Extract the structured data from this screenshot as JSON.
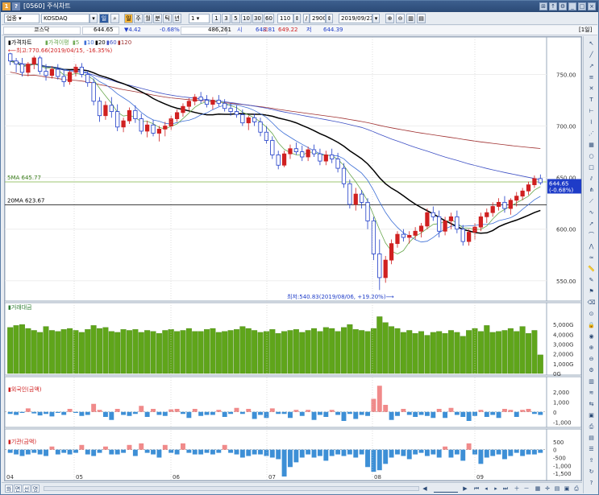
{
  "window": {
    "title": "[0560] 주식차트",
    "app_icon": "1",
    "help_icon": "?"
  },
  "toolbar": {
    "market_select": "업종",
    "symbol": "KOSDAQ",
    "period_mode": "일",
    "period_buttons": [
      "주",
      "월",
      "분",
      "틱",
      "년"
    ],
    "interval_select": "1",
    "interval_buttons": [
      "1",
      "3",
      "5",
      "10",
      "30",
      "60"
    ],
    "count_value": "110",
    "total_value": "2900",
    "date_value": "2019/09/23"
  },
  "info": {
    "name": "코스닥",
    "price": "644.65",
    "change": "▼4.42",
    "change_pct": "-0.68%",
    "volume": "486,261",
    "open_label": "시",
    "open": "648.81",
    "high_label": "고",
    "high": "649.22",
    "low_label": "저",
    "low": "644.39",
    "unit_label": "[1일]"
  },
  "chart_data": [
    {
      "type": "candlestick",
      "panel": "price",
      "legend": [
        "가격차트",
        "가격이평",
        "5",
        "10",
        "20",
        "60",
        "120"
      ],
      "annotations": {
        "high": "최고:770.66(2019/04/15, -16.35%)",
        "low": "최저:540.83(2019/08/06, +19.20%)",
        "ma5_label": "5MA 645.77",
        "ma20_label": "20MA 623.67",
        "last_price": "644.65",
        "last_pct": "(-0.68%)"
      },
      "y_ticks": [
        "750.00",
        "700.00",
        "650.00",
        "600.00",
        "550.00"
      ],
      "ylim": [
        535,
        780
      ],
      "ohlc": [
        [
          770,
          771,
          759,
          763
        ],
        [
          763,
          766,
          752,
          760
        ],
        [
          760,
          766,
          748,
          752
        ],
        [
          752,
          762,
          748,
          760
        ],
        [
          760,
          768,
          755,
          766
        ],
        [
          766,
          768,
          750,
          753
        ],
        [
          753,
          760,
          744,
          749
        ],
        [
          749,
          758,
          746,
          755
        ],
        [
          755,
          760,
          745,
          748
        ],
        [
          748,
          754,
          738,
          743
        ],
        [
          743,
          754,
          740,
          752
        ],
        [
          752,
          760,
          748,
          757
        ],
        [
          757,
          761,
          747,
          750
        ],
        [
          750,
          754,
          738,
          742
        ],
        [
          742,
          746,
          720,
          724
        ],
        [
          724,
          728,
          704,
          710
        ],
        [
          710,
          724,
          706,
          720
        ],
        [
          720,
          728,
          708,
          714
        ],
        [
          714,
          721,
          695,
          699
        ],
        [
          699,
          708,
          694,
          705
        ],
        [
          705,
          718,
          702,
          715
        ],
        [
          715,
          720,
          703,
          707
        ],
        [
          707,
          712,
          692,
          695
        ],
        [
          695,
          705,
          689,
          701
        ],
        [
          701,
          706,
          690,
          693
        ],
        [
          693,
          700,
          685,
          697
        ],
        [
          697,
          704,
          690,
          700
        ],
        [
          700,
          710,
          696,
          707
        ],
        [
          707,
          716,
          704,
          713
        ],
        [
          713,
          722,
          709,
          719
        ],
        [
          719,
          727,
          715,
          724
        ],
        [
          724,
          731,
          720,
          728
        ],
        [
          728,
          733,
          722,
          725
        ],
        [
          725,
          730,
          718,
          721
        ],
        [
          721,
          728,
          716,
          725
        ],
        [
          725,
          730,
          719,
          722
        ],
        [
          722,
          726,
          714,
          717
        ],
        [
          717,
          722,
          710,
          714
        ],
        [
          714,
          720,
          708,
          711
        ],
        [
          711,
          716,
          700,
          703
        ],
        [
          703,
          710,
          696,
          708
        ],
        [
          708,
          712,
          700,
          704
        ],
        [
          704,
          708,
          690,
          694
        ],
        [
          694,
          700,
          683,
          686
        ],
        [
          686,
          690,
          668,
          672
        ],
        [
          672,
          676,
          658,
          662
        ],
        [
          662,
          676,
          660,
          673
        ],
        [
          673,
          682,
          668,
          678
        ],
        [
          678,
          684,
          672,
          675
        ],
        [
          675,
          681,
          666,
          670
        ],
        [
          670,
          680,
          666,
          677
        ],
        [
          677,
          682,
          670,
          673
        ],
        [
          673,
          678,
          662,
          666
        ],
        [
          666,
          676,
          662,
          672
        ],
        [
          672,
          678,
          664,
          668
        ],
        [
          668,
          674,
          655,
          659
        ],
        [
          659,
          664,
          640,
          644
        ],
        [
          644,
          648,
          620,
          624
        ],
        [
          624,
          640,
          618,
          634
        ],
        [
          634,
          638,
          620,
          626
        ],
        [
          626,
          630,
          600,
          608
        ],
        [
          608,
          612,
          570,
          576
        ],
        [
          576,
          590,
          541,
          553
        ],
        [
          553,
          574,
          548,
          570
        ],
        [
          570,
          590,
          566,
          586
        ],
        [
          586,
          598,
          582,
          595
        ],
        [
          595,
          600,
          588,
          592
        ],
        [
          592,
          598,
          586,
          594
        ],
        [
          594,
          602,
          590,
          598
        ],
        [
          598,
          606,
          592,
          603
        ],
        [
          603,
          620,
          600,
          616
        ],
        [
          616,
          622,
          608,
          612
        ],
        [
          612,
          618,
          592,
          598
        ],
        [
          598,
          612,
          594,
          608
        ],
        [
          608,
          616,
          600,
          612
        ],
        [
          612,
          618,
          596,
          600
        ],
        [
          600,
          604,
          584,
          588
        ],
        [
          588,
          600,
          584,
          597
        ],
        [
          597,
          606,
          590,
          602
        ],
        [
          602,
          616,
          598,
          612
        ],
        [
          612,
          620,
          606,
          616
        ],
        [
          616,
          626,
          612,
          622
        ],
        [
          622,
          630,
          618,
          626
        ],
        [
          626,
          632,
          616,
          620
        ],
        [
          620,
          630,
          614,
          628
        ],
        [
          628,
          636,
          622,
          632
        ],
        [
          632,
          640,
          628,
          637
        ],
        [
          637,
          646,
          633,
          643
        ],
        [
          643,
          652,
          640,
          649
        ],
        [
          649,
          653,
          643,
          645
        ]
      ],
      "series": [
        {
          "name": "5",
          "color": "#6aa84f"
        },
        {
          "name": "10",
          "color": "#3d6fd6"
        },
        {
          "name": "20",
          "color": "#000000"
        },
        {
          "name": "60",
          "color": "#3d4fc4"
        },
        {
          "name": "120",
          "color": "#a03030"
        }
      ]
    },
    {
      "type": "bar",
      "panel": "volume",
      "legend": "거래대금",
      "y_ticks": [
        "5,000G",
        "4,000G",
        "3,000G",
        "2,000G",
        "1,000G",
        "0G"
      ],
      "ylim": [
        0,
        6000
      ],
      "values": [
        4700,
        4900,
        5000,
        4600,
        4400,
        4200,
        4800,
        4400,
        4300,
        4500,
        4600,
        4400,
        4200,
        4500,
        4900,
        4600,
        4700,
        4300,
        4200,
        4500,
        4400,
        4500,
        4200,
        4400,
        4300,
        4100,
        4400,
        4500,
        4300,
        4400,
        4600,
        4300,
        4300,
        4500,
        4600,
        4200,
        4300,
        4400,
        4500,
        4800,
        4600,
        4400,
        4200,
        4300,
        4500,
        4100,
        4300,
        4400,
        4500,
        4200,
        4400,
        4600,
        4300,
        4700,
        4600,
        4300,
        4700,
        5000,
        4500,
        4400,
        4300,
        4600,
        5800,
        5200,
        4800,
        4600,
        4200,
        4400,
        4100,
        4300,
        3900,
        4200,
        4300,
        4100,
        4400,
        4200,
        3800,
        4400,
        4600,
        4300,
        4900,
        4200,
        4300,
        4400,
        4600,
        4300,
        4800,
        4100,
        4400,
        1900
      ]
    },
    {
      "type": "bar",
      "panel": "foreign",
      "legend": "외국인(금액)",
      "y_ticks": [
        "2,000",
        "1,000",
        "0",
        "-1,000"
      ],
      "ylim": [
        -1300,
        2700
      ],
      "values": [
        -200,
        -300,
        -100,
        350,
        -150,
        -350,
        -200,
        -450,
        -100,
        -300,
        300,
        -100,
        -400,
        -300,
        800,
        200,
        -500,
        -800,
        300,
        -300,
        -400,
        -200,
        600,
        -500,
        300,
        -300,
        -400,
        250,
        300,
        -200,
        -600,
        300,
        -400,
        -300,
        -300,
        200,
        -500,
        -200,
        400,
        -200,
        300,
        -700,
        -300,
        -600,
        350,
        -200,
        -200,
        -600,
        200,
        -400,
        200,
        -800,
        -300,
        -500,
        200,
        -300,
        -900,
        -200,
        -700,
        -300,
        -400,
        1300,
        2600,
        700,
        -800,
        -400,
        300,
        -300,
        -500,
        -300,
        -400,
        -600,
        300,
        -600,
        400,
        -300,
        -500,
        -900,
        -400,
        200,
        -500,
        -300,
        -600,
        300,
        200,
        -500,
        200,
        300,
        -200,
        -300
      ]
    },
    {
      "type": "bar",
      "panel": "institution",
      "legend": "기관(금액)",
      "y_ticks": [
        "500",
        "0",
        "-500",
        "-1,000",
        "-1,500"
      ],
      "ylim": [
        -1800,
        800
      ],
      "values": [
        -200,
        -300,
        -400,
        -300,
        -200,
        -300,
        -400,
        200,
        -300,
        -200,
        -300,
        -200,
        300,
        -300,
        -400,
        -200,
        200,
        -300,
        -300,
        -200,
        300,
        -400,
        400,
        -200,
        -300,
        -500,
        300,
        -200,
        -300,
        400,
        -200,
        -300,
        -300,
        -200,
        -300,
        -200,
        300,
        -200,
        -300,
        -500,
        -400,
        -300,
        -300,
        -400,
        -500,
        -600,
        -1700,
        -1100,
        -800,
        -500,
        -300,
        -500,
        -400,
        -700,
        -400,
        -300,
        -400,
        -300,
        -500,
        -300,
        -1100,
        -1400,
        -1300,
        -900,
        -500,
        -300,
        -400,
        -600,
        -300,
        -200,
        -400,
        -300,
        -500,
        200,
        -500,
        -300,
        -700,
        400,
        -300,
        -900,
        -500,
        -400,
        -300,
        -600,
        -400,
        -200,
        -400,
        -300,
        -300,
        -200
      ]
    }
  ],
  "x_axis": {
    "labels": [
      "04",
      "05",
      "06",
      "07",
      "08",
      "09"
    ]
  },
  "rightbar_icons": [
    "arrow-icon",
    "line-icon",
    "trend-icon",
    "fib-icon",
    "cross-icon",
    "text-icon",
    "measure-icon",
    "zigzag-icon",
    "fan-icon",
    "grid-icon",
    "circle-icon",
    "rect-icon",
    "channel-icon",
    "andrews-icon",
    "gann-icon",
    "cycle-icon",
    "speed-icon",
    "arc-icon",
    "pitch-icon",
    "wave-icon",
    "ruler-icon",
    "marker-icon",
    "flag-icon",
    "eraser-icon",
    "magnet-icon",
    "lock-icon",
    "eye-icon",
    "zoom-in-icon",
    "zoom-out-icon",
    "settings-icon",
    "chart-icon",
    "indicator-icon",
    "compare-icon",
    "save-icon",
    "print-icon",
    "layout-icon",
    "list-icon",
    "export-icon",
    "refresh-icon",
    "help-icon"
  ],
  "bottombar": {
    "tabs": [
      "화",
      "면",
      "선",
      "명"
    ]
  }
}
